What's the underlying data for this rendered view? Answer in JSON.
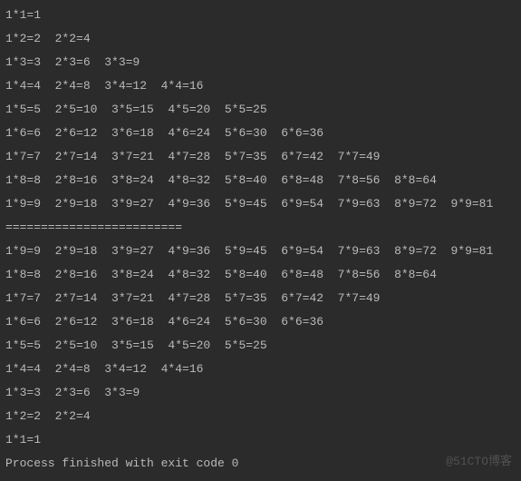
{
  "output": {
    "lines": [
      "1*1=1",
      "1*2=2  2*2=4",
      "1*3=3  2*3=6  3*3=9",
      "1*4=4  2*4=8  3*4=12  4*4=16",
      "1*5=5  2*5=10  3*5=15  4*5=20  5*5=25",
      "1*6=6  2*6=12  3*6=18  4*6=24  5*6=30  6*6=36",
      "1*7=7  2*7=14  3*7=21  4*7=28  5*7=35  6*7=42  7*7=49",
      "1*8=8  2*8=16  3*8=24  4*8=32  5*8=40  6*8=48  7*8=56  8*8=64",
      "1*9=9  2*9=18  3*9=27  4*9=36  5*9=45  6*9=54  7*9=63  8*9=72  9*9=81",
      "=========================",
      "1*9=9  2*9=18  3*9=27  4*9=36  5*9=45  6*9=54  7*9=63  8*9=72  9*9=81",
      "1*8=8  2*8=16  3*8=24  4*8=32  5*8=40  6*8=48  7*8=56  8*8=64",
      "1*7=7  2*7=14  3*7=21  4*7=28  5*7=35  6*7=42  7*7=49",
      "1*6=6  2*6=12  3*6=18  4*6=24  5*6=30  6*6=36",
      "1*5=5  2*5=10  3*5=15  4*5=20  5*5=25",
      "1*4=4  2*4=8  3*4=12  4*4=16",
      "1*3=3  2*3=6  3*3=9",
      "1*2=2  2*2=4",
      "1*1=1",
      "",
      "Process finished with exit code 0"
    ]
  },
  "watermark": "@51CTO博客"
}
